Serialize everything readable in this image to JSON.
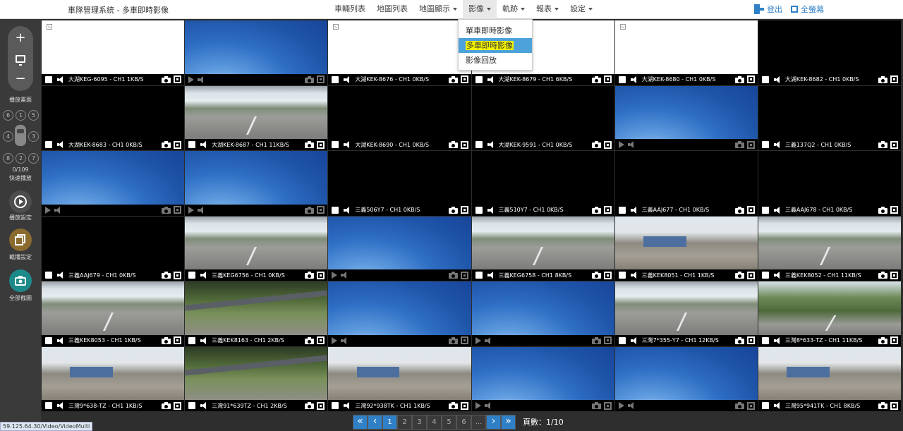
{
  "header": {
    "title": "車隊管理系統 - 多車即時影像",
    "nav": [
      {
        "label": "車輛列表",
        "has_caret": false,
        "active": false
      },
      {
        "label": "地圖列表",
        "has_caret": false,
        "active": false
      },
      {
        "label": "地圖顯示",
        "has_caret": true,
        "active": false
      },
      {
        "label": "影像",
        "has_caret": true,
        "active": true
      },
      {
        "label": "軌跡",
        "has_caret": true,
        "active": false
      },
      {
        "label": "報表",
        "has_caret": true,
        "active": false
      },
      {
        "label": "設定",
        "has_caret": true,
        "active": false
      }
    ],
    "logout_label": "登出",
    "fullscreen_label": "全螢幕"
  },
  "dropdown": {
    "items": [
      {
        "label": "單車即時影像",
        "active": false
      },
      {
        "label": "多車即時影像",
        "active": true
      },
      {
        "label": "影像回放",
        "active": false
      }
    ]
  },
  "sidebar": {
    "zoom_in": "+",
    "zoom_out": "−",
    "playback_screen_label": "播放畫面",
    "directions": [
      "6",
      "1",
      "5",
      "4",
      "3",
      "8",
      "2",
      "7"
    ],
    "progress": "0/109",
    "fast_play_label": "快速播放",
    "play_settings_label": "播放設定",
    "record_settings_label": "載播設定",
    "capture_all_label": "全部截圖"
  },
  "colors": {
    "accent": "#2f80c7",
    "dropdown_highlight": "#4da2d9",
    "label_highlight": "#f3f300",
    "grid_bg": "#2e2e2e"
  },
  "grid": {
    "cells": [
      {
        "label": "大湖KEG-6095 - CH1 1KB/S",
        "bg": "white",
        "dim": false
      },
      {
        "label": "",
        "bg": "blue",
        "dim": true
      },
      {
        "label": "大湖KEK-8676 - CH1 0KB/S",
        "bg": "white",
        "dim": false
      },
      {
        "label": "大湖KEK-8679 - CH1 6KB/S",
        "bg": "white",
        "dim": false
      },
      {
        "label": "大湖KEK-8680 - CH1 0KB/S",
        "bg": "white",
        "dim": false
      },
      {
        "label": "大湖KEK-8682 - CH1 0KB/S",
        "bg": "black",
        "dim": false
      },
      {
        "label": "大湖KEK-8683 - CH1 0KB/S",
        "bg": "black",
        "dim": false
      },
      {
        "label": "大湖KEK-8687 - CH1 11KB/S",
        "bg": "road",
        "dim": false
      },
      {
        "label": "大湖KEK-8690 - CH1 0KB/S",
        "bg": "black",
        "dim": false
      },
      {
        "label": "大湖KEK-9591 - CH1 0KB/S",
        "bg": "black",
        "dim": false
      },
      {
        "label": "",
        "bg": "blue",
        "dim": true
      },
      {
        "label": "三義137Q2 - CH1 0KB/S",
        "bg": "black",
        "dim": false
      },
      {
        "label": "",
        "bg": "blue",
        "dim": true
      },
      {
        "label": "",
        "bg": "blue",
        "dim": true
      },
      {
        "label": "三義506Y7 - CH1 0KB/S",
        "bg": "black",
        "dim": false
      },
      {
        "label": "三義510Y7 - CH1 0KB/S",
        "bg": "black",
        "dim": false
      },
      {
        "label": "三義AAJ677 - CH1 0KB/S",
        "bg": "black",
        "dim": false
      },
      {
        "label": "三義AAJ678 - CH1 0KB/S",
        "bg": "black",
        "dim": false
      },
      {
        "label": "三義AAJ679 - CH1 0KB/S",
        "bg": "black",
        "dim": false
      },
      {
        "label": "三義KEG6756 - CH1 0KB/S",
        "bg": "road",
        "dim": false
      },
      {
        "label": "",
        "bg": "blue",
        "dim": true
      },
      {
        "label": "三義KEG6758 - CH1 8KB/S",
        "bg": "road",
        "dim": false
      },
      {
        "label": "三義KEK8051 - CH1 1KB/S",
        "bg": "site",
        "dim": false
      },
      {
        "label": "三義KEK8052 - CH1 11KB/S",
        "bg": "road",
        "dim": false
      },
      {
        "label": "三義KEK8053 - CH1 1KB/S",
        "bg": "road",
        "dim": false
      },
      {
        "label": "三義KEK8163 - CH1 2KB/S",
        "bg": "forest",
        "dim": false
      },
      {
        "label": "",
        "bg": "blue",
        "dim": true
      },
      {
        "label": "",
        "bg": "blue",
        "dim": true
      },
      {
        "label": "三灣7*355-Y7 - CH1 12KB/S",
        "bg": "road",
        "dim": false
      },
      {
        "label": "三灣8*633-TZ - CH1 11KB/S",
        "bg": "green",
        "dim": false
      },
      {
        "label": "三灣9*638-TZ - CH1 1KB/S",
        "bg": "site",
        "dim": false
      },
      {
        "label": "三灣91*639TZ - CH1 2KB/S",
        "bg": "forest",
        "dim": false
      },
      {
        "label": "三灣92*938TK - CH1 1KB/S",
        "bg": "site",
        "dim": false
      },
      {
        "label": "",
        "bg": "blue",
        "dim": true
      },
      {
        "label": "",
        "bg": "blue",
        "dim": true
      },
      {
        "label": "三灣95*941TK - CH1 8KB/S",
        "bg": "site",
        "dim": false
      }
    ]
  },
  "pagination": {
    "first": "«",
    "prev": "‹",
    "pages": [
      "1",
      "2",
      "3",
      "4",
      "5",
      "6",
      "..."
    ],
    "current": "1",
    "next": "›",
    "last": "»",
    "page_count_label": "頁數：1/10"
  },
  "status_url": "59.125.64.30/Video/VideoMulti"
}
